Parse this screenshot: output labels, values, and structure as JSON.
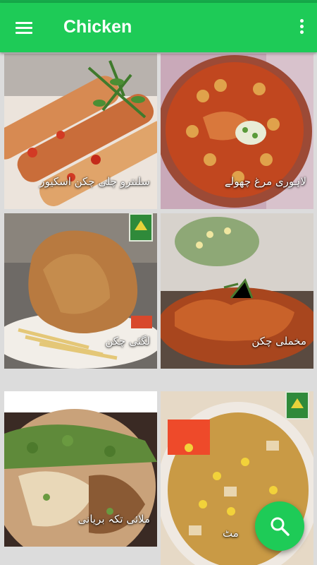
{
  "app_bar": {
    "title": "Chicken",
    "menu_icon": "hamburger-menu-icon",
    "overflow_icon": "more-vert-icon"
  },
  "recipes": [
    {
      "name": "سلنترو چلی چکن اسکیور"
    },
    {
      "name": "لاہوری مرغ چھولے"
    },
    {
      "name": "لگئی چکن"
    },
    {
      "name": "مخملی چکن"
    },
    {
      "name": "ملائی تکہ بریانی"
    },
    {
      "name": "مٹ"
    }
  ],
  "fab": {
    "icon": "search-icon"
  },
  "colors": {
    "primary": "#1ecb57",
    "status_bar": "#16a94a"
  }
}
